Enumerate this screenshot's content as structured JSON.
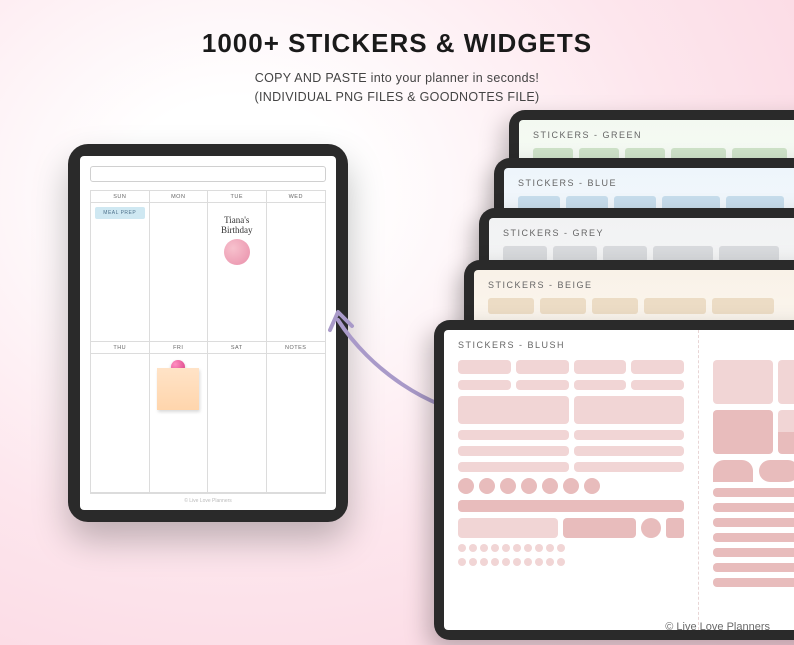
{
  "headline": {
    "title": "1000+ STICKERS & WIDGETS",
    "line1": "COPY AND PASTE into your planner in seconds!",
    "line2": "(INDIVIDUAL PNG FILES & GOODNOTES FILE)"
  },
  "planner": {
    "days_row1": [
      "SUN",
      "MON",
      "TUE",
      "WED"
    ],
    "days_row2": [
      "THU",
      "FRI",
      "SAT",
      "NOTES"
    ],
    "meal_prep": "MEAL PREP",
    "birthday": "Tiana's Birthday",
    "footer": "© Live Love Planners"
  },
  "sticker_books": [
    {
      "label": "STICKERS - GREEN",
      "tint": "green"
    },
    {
      "label": "STICKERS - BLUE",
      "tint": "blue"
    },
    {
      "label": "STICKERS - GREY",
      "tint": "grey"
    },
    {
      "label": "STICKERS - BEIGE",
      "tint": "beige"
    },
    {
      "label": "STICKERS - BLUSH",
      "tint": "blush"
    }
  ],
  "copyright": "© Live Love Planners"
}
